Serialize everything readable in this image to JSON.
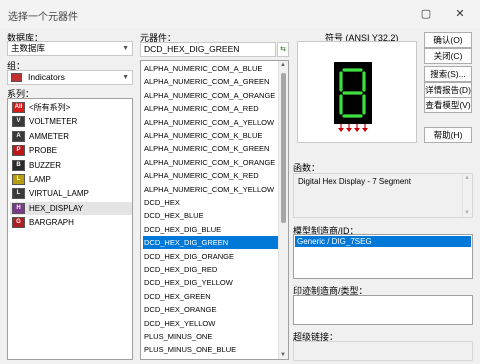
{
  "window": {
    "title": "选择一个元器件",
    "maximize_glyph": "▢",
    "close_glyph": "✕"
  },
  "database": {
    "label": "数据库：",
    "value": "主数据库"
  },
  "group": {
    "label": "组：",
    "value": "Indicators"
  },
  "series": {
    "label": "系列：",
    "items": [
      {
        "label": "<所有系列>",
        "icon": "all-series-icon",
        "icon_text": "All",
        "icon_color": "#d91a1a"
      },
      {
        "label": "VOLTMETER",
        "icon": "voltmeter-icon",
        "icon_text": "V",
        "icon_color": "#3a3a3a"
      },
      {
        "label": "AMMETER",
        "icon": "ammeter-icon",
        "icon_text": "A",
        "icon_color": "#3a3a3a"
      },
      {
        "label": "PROBE",
        "icon": "probe-icon",
        "icon_text": "P",
        "icon_color": "#c01818"
      },
      {
        "label": "BUZZER",
        "icon": "buzzer-icon",
        "icon_text": "B",
        "icon_color": "#2b2b2b"
      },
      {
        "label": "LAMP",
        "icon": "lamp-icon",
        "icon_text": "L",
        "icon_color": "#b89c10"
      },
      {
        "label": "VIRTUAL_LAMP",
        "icon": "virtual-lamp-icon",
        "icon_text": "L",
        "icon_color": "#3a3a3a"
      },
      {
        "label": "HEX_DISPLAY",
        "icon": "hex-display-icon",
        "icon_text": "H",
        "icon_color": "#7a3a8a"
      },
      {
        "label": "BARGRAPH",
        "icon": "bargraph-icon",
        "icon_text": "G",
        "icon_color": "#b02020"
      }
    ],
    "selected_index": 7
  },
  "component": {
    "label": "元器件：",
    "value": "DCD_HEX_DIG_GREEN",
    "filter_icon": "filter-icon",
    "items": [
      "ALPHA_NUMERIC_COM_A_BLUE",
      "ALPHA_NUMERIC_COM_A_GREEN",
      "ALPHA_NUMERIC_COM_A_ORANGE",
      "ALPHA_NUMERIC_COM_A_RED",
      "ALPHA_NUMERIC_COM_A_YELLOW",
      "ALPHA_NUMERIC_COM_K_BLUE",
      "ALPHA_NUMERIC_COM_K_GREEN",
      "ALPHA_NUMERIC_COM_K_ORANGE",
      "ALPHA_NUMERIC_COM_K_RED",
      "ALPHA_NUMERIC_COM_K_YELLOW",
      "DCD_HEX",
      "DCD_HEX_BLUE",
      "DCD_HEX_DIG_BLUE",
      "DCD_HEX_DIG_GREEN",
      "DCD_HEX_DIG_ORANGE",
      "DCD_HEX_DIG_RED",
      "DCD_HEX_DIG_YELLOW",
      "DCD_HEX_GREEN",
      "DCD_HEX_ORANGE",
      "DCD_HEX_YELLOW",
      "PLUS_MINUS_ONE",
      "PLUS_MINUS_ONE_BLUE"
    ],
    "selected_index": 13
  },
  "symbol": {
    "label": "符号 (ANSI Y32.2)",
    "digit_color": "#3ee03e",
    "pin_color": "#cc0000"
  },
  "buttons": {
    "confirm": "确认(O)",
    "close": "关闭(C)",
    "search": "搜索(S)...",
    "details": "详情报告(D)",
    "view_model": "查看模型(V)",
    "help": "帮助(H)"
  },
  "function": {
    "label": "函数：",
    "text": "Digital Hex Display - 7 Segment"
  },
  "model_mfr": {
    "label": "模型制造商/ID：",
    "items": [
      "Generic / DIG_7SEG"
    ]
  },
  "footprint_mfr": {
    "label": "印迹制造商/类型："
  },
  "hyperlink": {
    "label": "超级链接："
  },
  "colors": {
    "selection": "#0078d7",
    "window_bg": "#f0f0f0"
  }
}
